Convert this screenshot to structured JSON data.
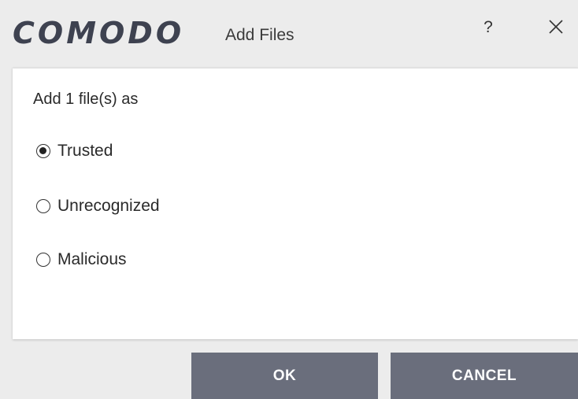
{
  "window": {
    "logo_text": "COMODO",
    "title": "Add Files",
    "help_label": "?",
    "close_icon": "close-icon"
  },
  "dialog": {
    "prompt": "Add 1 file(s) as",
    "options": [
      {
        "label": "Trusted",
        "checked": true
      },
      {
        "label": "Unrecognized",
        "checked": false
      },
      {
        "label": "Malicious",
        "checked": false
      }
    ]
  },
  "buttons": {
    "ok_label": "OK",
    "cancel_label": "CANCEL"
  },
  "colors": {
    "background": "#ececec",
    "panel": "#ffffff",
    "button": "#6a6e7c",
    "logo": "#3e4250"
  }
}
